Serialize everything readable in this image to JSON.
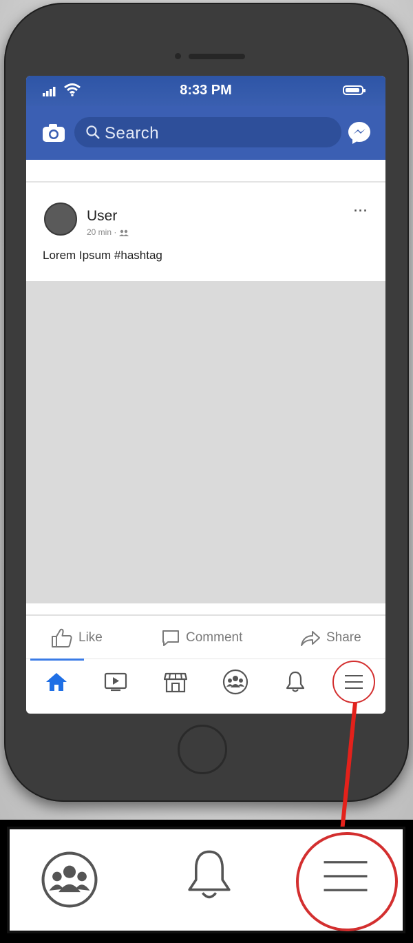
{
  "status": {
    "time": "8:33 PM"
  },
  "search": {
    "placeholder": "Search"
  },
  "post": {
    "username": "User",
    "meta": "20 min ·",
    "more": "···",
    "text": "Lorem Ipsum #hashtag"
  },
  "actions": {
    "like": "Like",
    "comment": "Comment",
    "share": "Share"
  },
  "colors": {
    "brand": "#3b5fb3",
    "active": "#1f6fe5",
    "highlight": "#d32f2f"
  },
  "tabs": [
    {
      "icon": "home-icon",
      "active": true
    },
    {
      "icon": "watch-icon"
    },
    {
      "icon": "marketplace-icon"
    },
    {
      "icon": "groups-icon"
    },
    {
      "icon": "bell-icon"
    },
    {
      "icon": "menu-icon",
      "highlighted": true
    }
  ],
  "zoom_icons": [
    "groups-icon",
    "bell-icon",
    "menu-icon"
  ]
}
